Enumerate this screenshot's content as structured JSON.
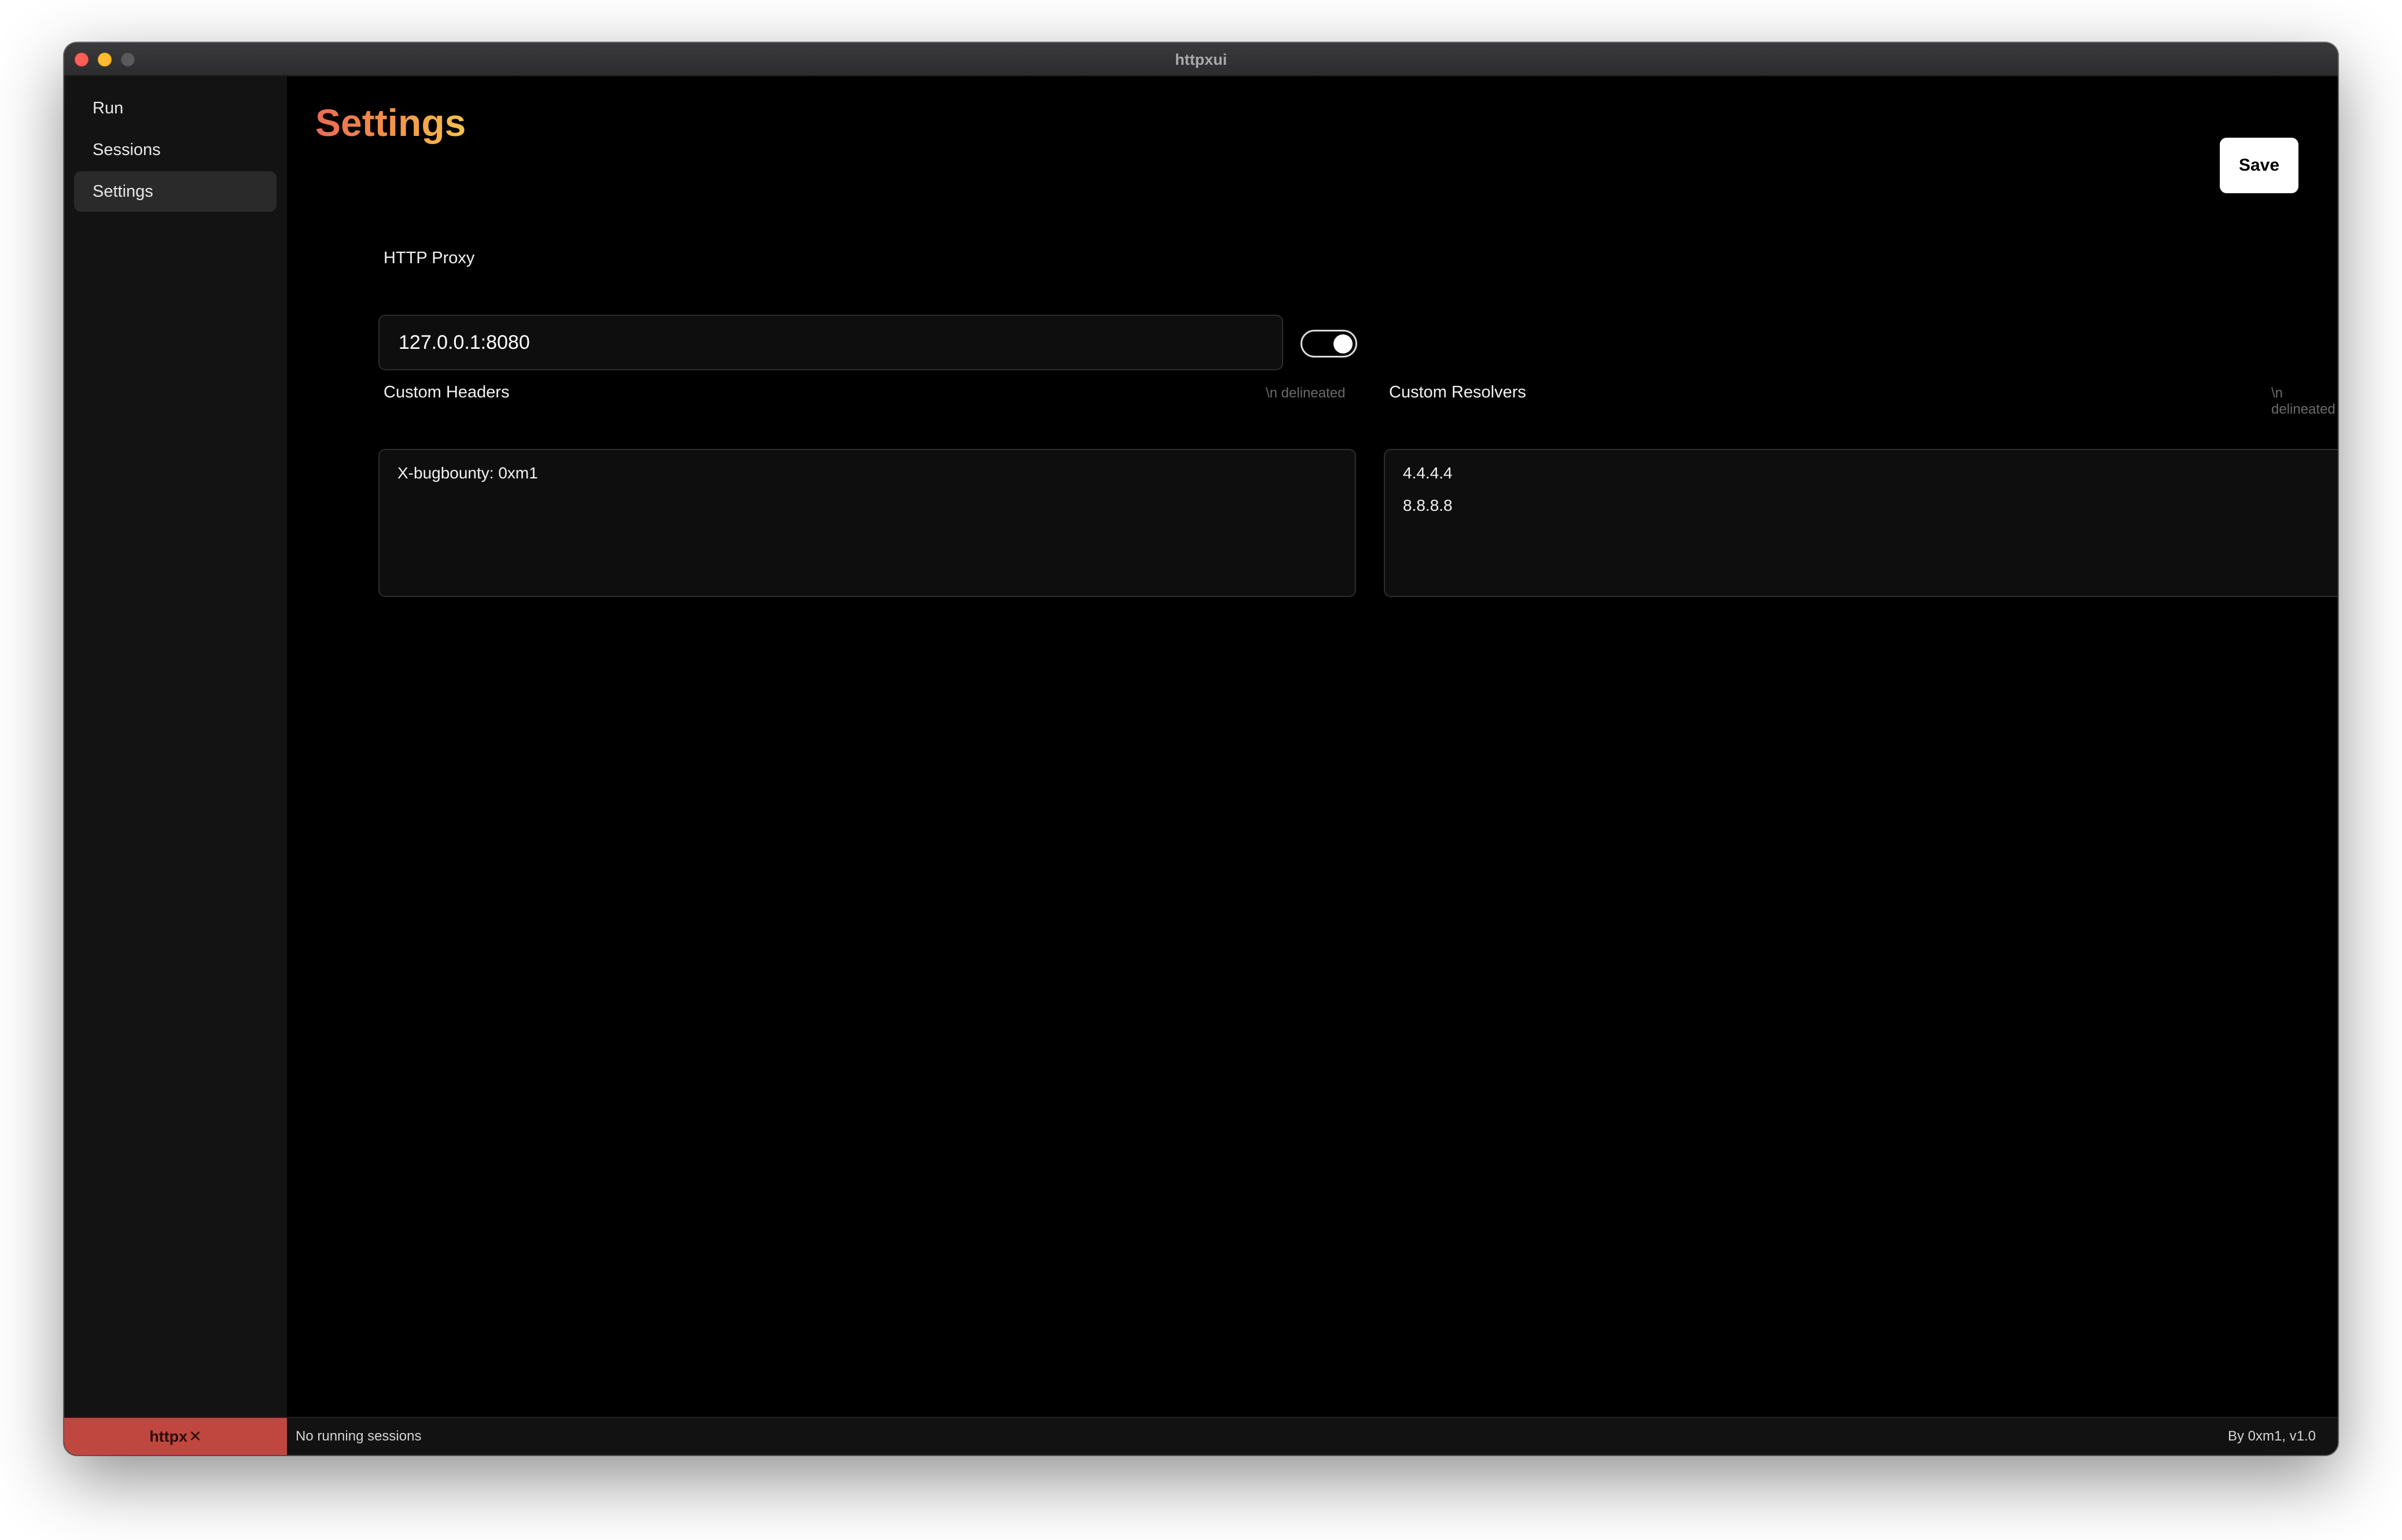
{
  "window": {
    "title": "httpxui"
  },
  "sidebar": {
    "items": [
      {
        "label": "Run",
        "active": false
      },
      {
        "label": "Sessions",
        "active": false
      },
      {
        "label": "Settings",
        "active": true
      }
    ]
  },
  "page": {
    "title": "Settings",
    "save_label": "Save"
  },
  "proxy": {
    "label": "HTTP Proxy",
    "value": "127.0.0.1:8080",
    "enabled": true
  },
  "custom_headers": {
    "label": "Custom Headers",
    "hint": "\\n delineated",
    "lines": [
      "X-bugbounty: 0xm1"
    ]
  },
  "custom_resolvers": {
    "label": "Custom Resolvers",
    "hint": "\\n delineated",
    "lines": [
      "4.4.4.4",
      "8.8.8.8"
    ]
  },
  "statusbar": {
    "brand": "httpx",
    "brand_icon": "close-icon",
    "status": "No running sessions",
    "credit": "By 0xm1, v1.0"
  },
  "colors": {
    "title_gradient_start": "#ec6a52",
    "title_gradient_end": "#f7c24a",
    "brand_bg": "#c0473f"
  }
}
